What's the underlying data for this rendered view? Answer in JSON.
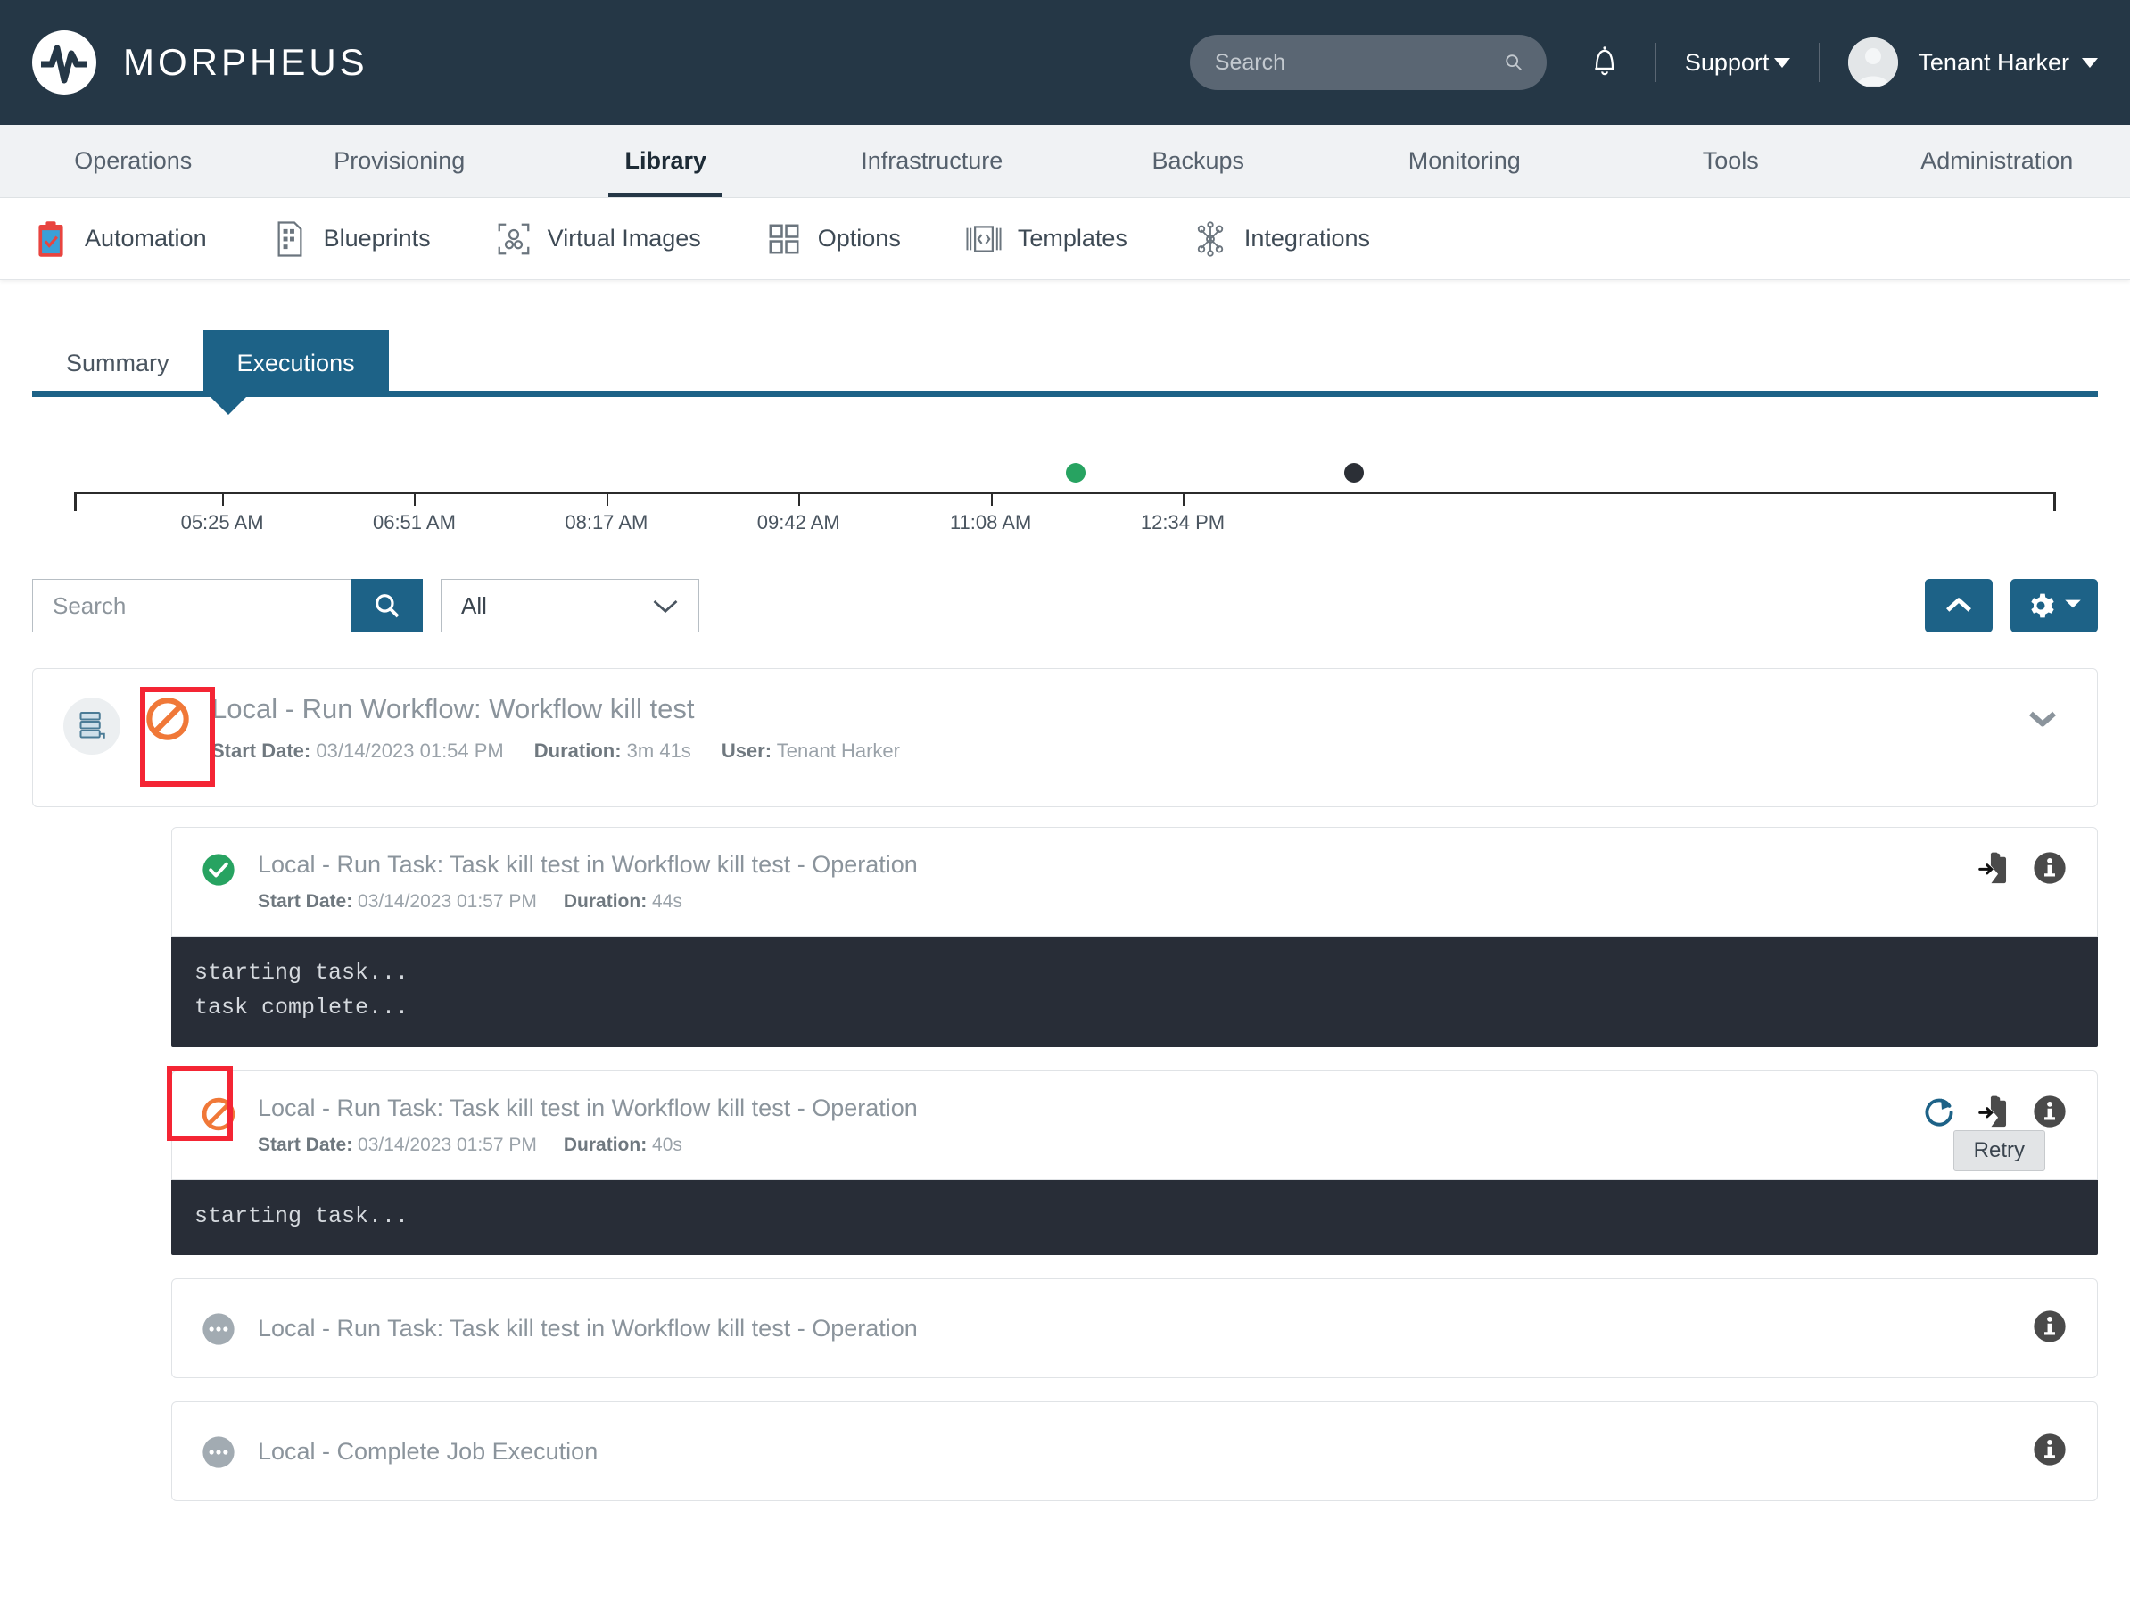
{
  "header": {
    "brand": "MORPHEUS",
    "logo_icon": "morpheus-logo-icon",
    "search_placeholder": "Search",
    "search_value": "",
    "search_icon": "search-icon",
    "bell_icon": "bell-icon",
    "support_label": "Support",
    "user_name": "Tenant Harker",
    "avatar_icon": "user-avatar-icon",
    "bar_color": "#253746"
  },
  "primary_nav": {
    "items": [
      {
        "label": "Operations",
        "active": false
      },
      {
        "label": "Provisioning",
        "active": false
      },
      {
        "label": "Library",
        "active": true
      },
      {
        "label": "Infrastructure",
        "active": false
      },
      {
        "label": "Backups",
        "active": false
      },
      {
        "label": "Monitoring",
        "active": false
      },
      {
        "label": "Tools",
        "active": false
      },
      {
        "label": "Administration",
        "active": false
      }
    ]
  },
  "sub_nav": {
    "items": [
      {
        "label": "Automation",
        "icon": "clipboard-check-icon",
        "active": true
      },
      {
        "label": "Blueprints",
        "icon": "blueprint-document-icon",
        "active": false
      },
      {
        "label": "Virtual Images",
        "icon": "virtual-images-icon",
        "active": false
      },
      {
        "label": "Options",
        "icon": "grid-squares-icon",
        "active": false
      },
      {
        "label": "Templates",
        "icon": "code-brackets-icon",
        "active": false
      },
      {
        "label": "Integrations",
        "icon": "nodes-network-icon",
        "active": false
      }
    ]
  },
  "tabs": [
    {
      "label": "Summary",
      "active": false
    },
    {
      "label": "Executions",
      "active": true
    }
  ],
  "accent_color": "#1d6287",
  "timeline": {
    "tick_labels": [
      "05:25 AM",
      "06:51 AM",
      "08:17 AM",
      "09:42 AM",
      "11:08 AM",
      "12:34 PM"
    ],
    "tick_positions_pct": [
      9.2,
      18.5,
      27.8,
      37.1,
      46.4,
      55.7
    ],
    "events": [
      {
        "position_pct": 50.5,
        "color": "#27a361",
        "status": "success"
      },
      {
        "position_pct": 64.0,
        "color": "#2b2f36",
        "status": "cancelled"
      }
    ]
  },
  "filters": {
    "search_placeholder": "Search",
    "search_value": "",
    "search_icon": "search-icon",
    "select_value": "All",
    "select_caret_icon": "chevron-down-icon",
    "collapse_icon": "chevron-up-icon",
    "gear_icon": "gear-icon",
    "gear_caret_icon": "caret-down-icon"
  },
  "execution": {
    "type_icon": "workflow-stack-icon",
    "status_icon": "cancelled-icon",
    "status_color": "#f07838",
    "title": "Local - Run Workflow: Workflow kill test",
    "start_date_label": "Start Date:",
    "start_date_value": "03/14/2023 01:54 PM",
    "duration_label": "Duration:",
    "duration_value": "3m 41s",
    "user_label": "User:",
    "user_value": "Tenant Harker",
    "expand_icon": "chevron-down-icon"
  },
  "subtasks": [
    {
      "status_icon": "check-circle-icon",
      "status_color": "#27a361",
      "title": "Local - Run Task: Task kill test in Workflow kill test - Operation",
      "start_date_label": "Start Date:",
      "start_date_value": "03/14/2023 01:57 PM",
      "duration_label": "Duration:",
      "duration_value": "44s",
      "actions": [
        "copy-to-clipboard-icon",
        "info-circle-icon"
      ],
      "output": "starting task...\ntask complete...",
      "has_output": true,
      "has_meta": true,
      "highlighted": false,
      "tooltip": ""
    },
    {
      "status_icon": "cancelled-icon",
      "status_color": "#f07838",
      "title": "Local - Run Task: Task kill test in Workflow kill test - Operation",
      "start_date_label": "Start Date:",
      "start_date_value": "03/14/2023 01:57 PM",
      "duration_label": "Duration:",
      "duration_value": "40s",
      "actions": [
        "retry-icon",
        "copy-to-clipboard-icon",
        "info-circle-icon"
      ],
      "output": "starting task...",
      "has_output": true,
      "has_meta": true,
      "highlighted": true,
      "tooltip": "Retry"
    },
    {
      "status_icon": "pending-dots-icon",
      "status_color": "#9aa2a9",
      "title": "Local - Run Task: Task kill test in Workflow kill test - Operation",
      "start_date_label": "",
      "start_date_value": "",
      "duration_label": "",
      "duration_value": "",
      "actions": [
        "info-circle-icon"
      ],
      "output": "",
      "has_output": false,
      "has_meta": false,
      "highlighted": false,
      "tooltip": ""
    },
    {
      "status_icon": "pending-dots-icon",
      "status_color": "#9aa2a9",
      "title": "Local - Complete Job Execution",
      "start_date_label": "",
      "start_date_value": "",
      "duration_label": "",
      "duration_value": "",
      "actions": [
        "info-circle-icon"
      ],
      "output": "",
      "has_output": false,
      "has_meta": false,
      "highlighted": false,
      "tooltip": ""
    }
  ],
  "annotation_color": "#f42534"
}
